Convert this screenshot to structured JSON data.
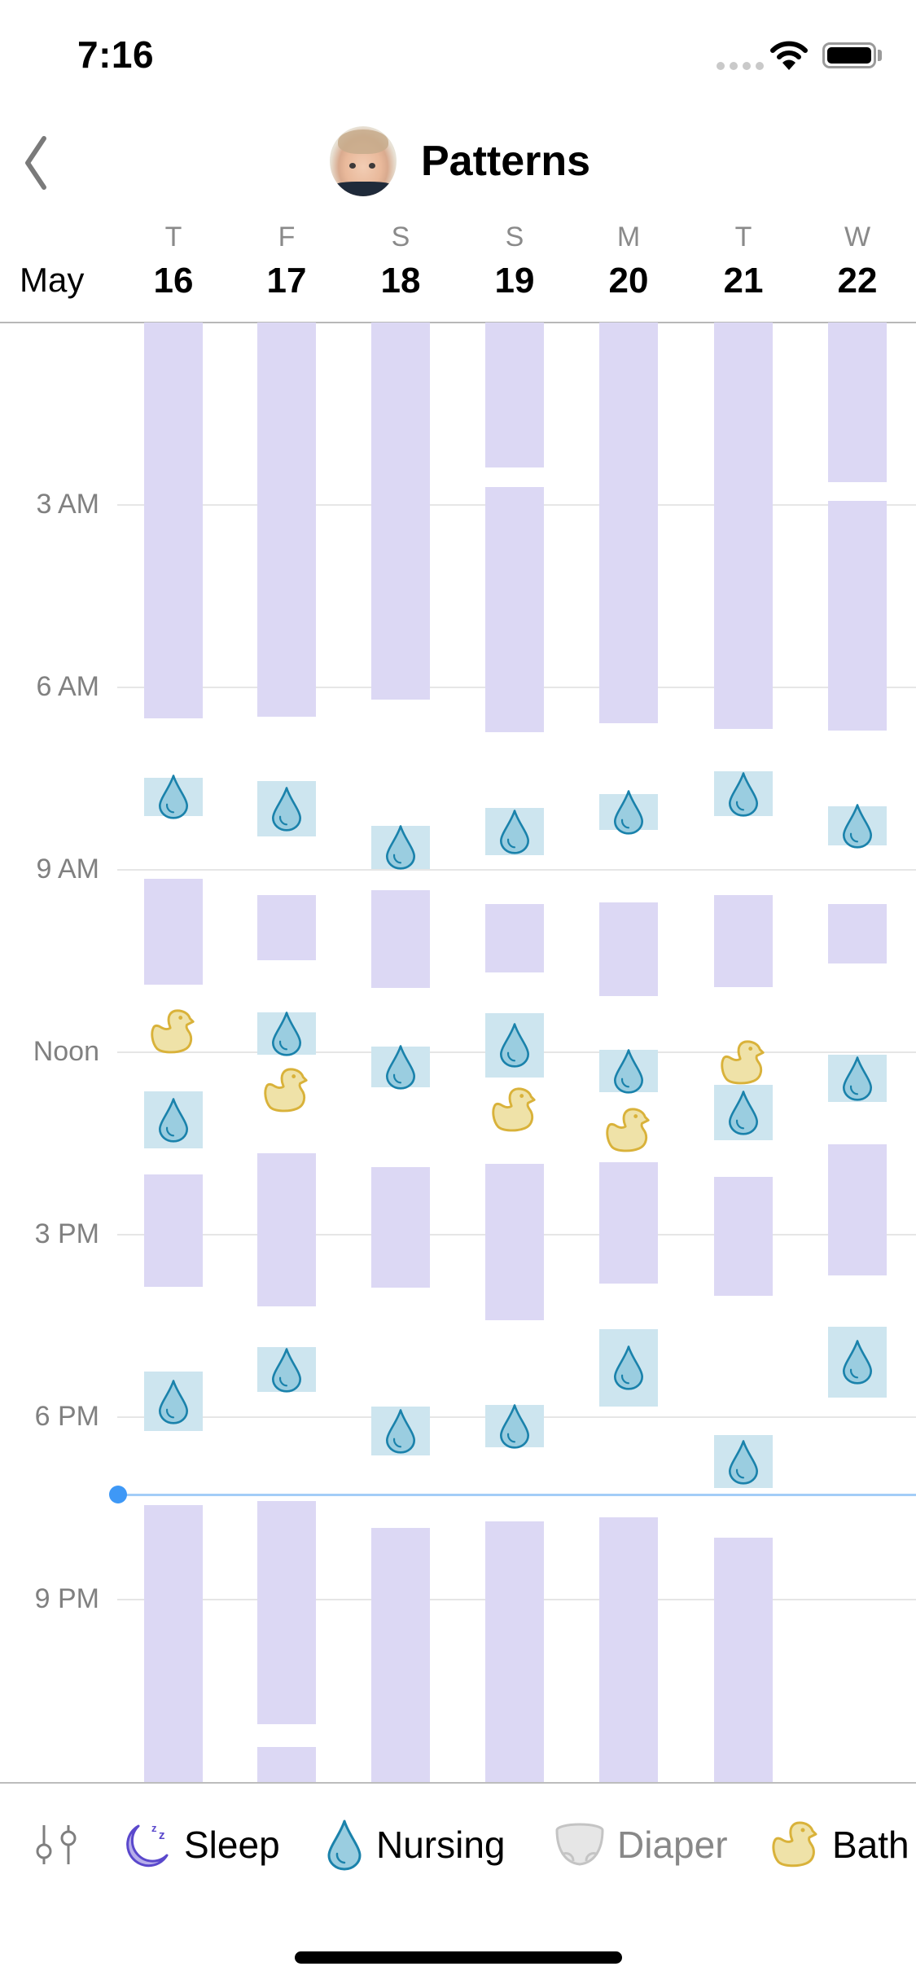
{
  "status_bar": {
    "time": "7:16",
    "signal_icon": "cellular-signal-icon",
    "wifi_icon": "wifi-icon",
    "battery_icon": "battery-icon"
  },
  "nav": {
    "back_icon": "chevron-left-icon",
    "avatar": "baby-avatar",
    "title": "Patterns"
  },
  "calendar": {
    "month": "May",
    "days": [
      {
        "weekday": "T",
        "date": "16"
      },
      {
        "weekday": "F",
        "date": "17"
      },
      {
        "weekday": "S",
        "date": "18"
      },
      {
        "weekday": "S",
        "date": "19"
      },
      {
        "weekday": "M",
        "date": "20"
      },
      {
        "weekday": "T",
        "date": "21"
      },
      {
        "weekday": "W",
        "date": "22"
      }
    ]
  },
  "legend": {
    "filter_icon": "sliders-icon",
    "items": [
      {
        "label": "Sleep",
        "icon": "moon-zzz-icon",
        "active": true
      },
      {
        "label": "Nursing",
        "icon": "droplet-icon",
        "active": true
      },
      {
        "label": "Diaper",
        "icon": "diaper-icon",
        "active": false
      },
      {
        "label": "Bath",
        "icon": "rubber-duck-icon",
        "active": true
      }
    ]
  },
  "colors": {
    "sleep": "#dcd8f4",
    "nursing_bg": "#cde5ef",
    "nursing_icon": "#9acde0",
    "nursing_stroke": "#1a82ab",
    "bath_fill": "#efe2a8",
    "bath_stroke": "#d9b23a",
    "now_line": "#a3cdf7",
    "now_dot": "#3e98f6"
  },
  "chart_data": {
    "type": "timeline",
    "title": "Patterns",
    "x": [
      "May 16",
      "May 17",
      "May 18",
      "May 19",
      "May 20",
      "May 21",
      "May 22"
    ],
    "y_axis": {
      "range_hours": [
        0,
        24
      ],
      "tick_hours": [
        3,
        6,
        9,
        12,
        15,
        18,
        21
      ],
      "tick_labels": [
        "3 AM",
        "6 AM",
        "9 AM",
        "Noon",
        "3 PM",
        "6 PM",
        "9 PM"
      ],
      "grid": true
    },
    "now_hour": 19.27,
    "now_label": "7:16",
    "series": [
      {
        "name": "Sleep",
        "kind": "interval",
        "values": [
          [
            [
              0,
              6.51
            ],
            [
              9.15,
              10.89
            ],
            [
              14.01,
              15.85
            ],
            [
              19.45,
              24
            ]
          ],
          [
            [
              0,
              6.48
            ],
            [
              9.41,
              10.49
            ],
            [
              13.66,
              16.18
            ],
            [
              19.38,
              23.05
            ],
            [
              23.42,
              24
            ]
          ],
          [
            [
              0,
              6.2
            ],
            [
              9.33,
              10.94
            ],
            [
              13.89,
              15.87
            ],
            [
              19.82,
              24
            ]
          ],
          [
            [
              0,
              2.39
            ],
            [
              2.71,
              6.74
            ],
            [
              9.56,
              10.69
            ],
            [
              13.84,
              16.41
            ],
            [
              19.72,
              24
            ]
          ],
          [
            [
              0,
              6.59
            ],
            [
              9.53,
              11.07
            ],
            [
              13.81,
              15.8
            ],
            [
              19.65,
              24
            ]
          ],
          [
            [
              0,
              6.68
            ],
            [
              9.41,
              10.93
            ],
            [
              14.05,
              16.0
            ],
            [
              19.98,
              24
            ]
          ],
          [
            [
              0,
              2.63
            ],
            [
              2.93,
              6.71
            ],
            [
              9.56,
              10.54
            ],
            [
              13.51,
              15.67
            ]
          ]
        ]
      },
      {
        "name": "Nursing",
        "kind": "interval",
        "values": [
          [
            [
              7.48,
              8.11
            ],
            [
              12.64,
              13.58
            ],
            [
              17.25,
              18.23
            ]
          ],
          [
            [
              7.54,
              8.45
            ],
            [
              11.34,
              12.04
            ],
            [
              16.85,
              17.59
            ]
          ],
          [
            [
              8.27,
              8.98
            ],
            [
              11.9,
              12.58
            ],
            [
              17.83,
              18.63
            ]
          ],
          [
            [
              7.98,
              8.76
            ],
            [
              11.35,
              12.41
            ],
            [
              17.8,
              18.49
            ]
          ],
          [
            [
              7.76,
              8.34
            ],
            [
              11.96,
              12.66
            ],
            [
              16.55,
              17.82
            ]
          ],
          [
            [
              7.38,
              8.12
            ],
            [
              12.53,
              13.45
            ],
            [
              18.3,
              19.16
            ]
          ],
          [
            [
              7.95,
              8.6
            ],
            [
              12.04,
              12.82
            ],
            [
              16.51,
              17.68
            ]
          ]
        ]
      },
      {
        "name": "Bath",
        "kind": "point",
        "values": [
          [
            11.67
          ],
          [
            12.63
          ],
          [],
          [
            12.95
          ],
          [
            13.29
          ],
          [
            12.17
          ],
          []
        ]
      }
    ]
  }
}
